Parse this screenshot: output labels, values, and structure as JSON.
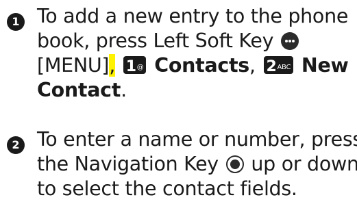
{
  "steps": [
    {
      "number": "1",
      "line1": "To add a new entry to the phone",
      "line2_prefix": "book, press Left Soft Key",
      "menu_label": "[MENU]",
      "comma": ",",
      "key1": {
        "digit": "1",
        "letters": "@"
      },
      "contacts_label": "Contacts",
      "comma2": ",",
      "key2": {
        "digit": "2",
        "letters": "ABC"
      },
      "new_label": "New",
      "contact_label": "Contact",
      "period": "."
    },
    {
      "number": "2",
      "line1": "To enter a name or number, press",
      "line2_prefix": "the Navigation Key",
      "line2_suffix": "up or down",
      "line3": "to select the contact fields."
    }
  ],
  "icons": {
    "left_soft_key": "left-soft-key-icon",
    "navigation_key": "navigation-key-icon"
  },
  "colors": {
    "highlight": "#fff200",
    "text": "#1a1a1a"
  }
}
